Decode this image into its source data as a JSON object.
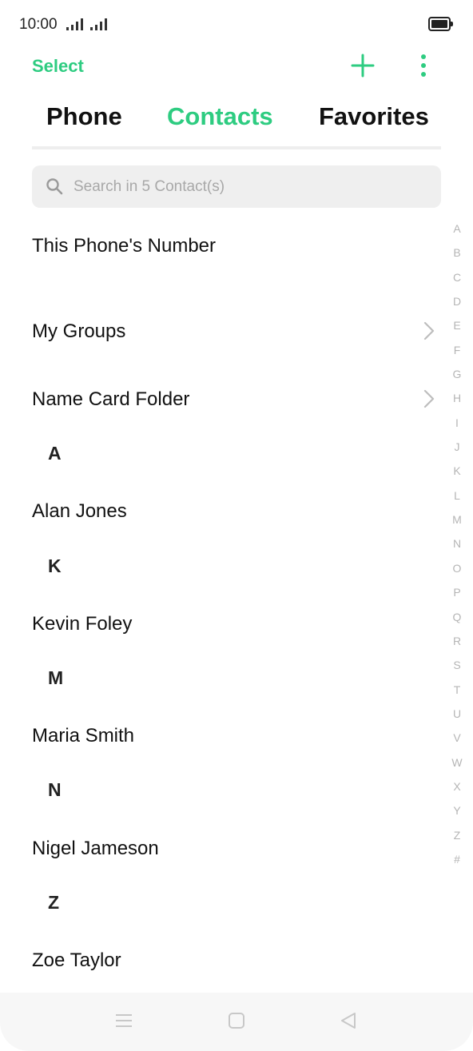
{
  "status_bar": {
    "time": "10:00"
  },
  "header": {
    "select_label": "Select"
  },
  "tabs": [
    {
      "label": "Phone",
      "active": false
    },
    {
      "label": "Contacts",
      "active": true
    },
    {
      "label": "Favorites",
      "active": false
    }
  ],
  "search": {
    "placeholder": "Search in 5 Contact(s)"
  },
  "menu_rows": {
    "this_phone": "This Phone's Number",
    "my_groups": "My Groups",
    "name_card_folder": "Name Card Folder"
  },
  "sections": [
    {
      "letter": "A",
      "contact": "Alan Jones"
    },
    {
      "letter": "K",
      "contact": "Kevin Foley"
    },
    {
      "letter": "M",
      "contact": "Maria Smith"
    },
    {
      "letter": "N",
      "contact": "Nigel Jameson"
    },
    {
      "letter": "Z",
      "contact": "Zoe Taylor"
    }
  ],
  "alphabet_index": [
    "A",
    "B",
    "C",
    "D",
    "E",
    "F",
    "G",
    "H",
    "I",
    "J",
    "K",
    "L",
    "M",
    "N",
    "O",
    "P",
    "Q",
    "R",
    "S",
    "T",
    "U",
    "V",
    "W",
    "X",
    "Y",
    "Z",
    "#"
  ],
  "colors": {
    "accent": "#2ecc81",
    "index_text": "#b5b5b5",
    "search_bg": "#efefef"
  },
  "icons": {
    "add": "plus-icon",
    "more": "more-vertical-icon",
    "search": "search-icon",
    "chevron": "chevron-right-icon",
    "nav_menu": "menu-icon",
    "nav_home": "home-icon",
    "nav_back": "back-icon"
  }
}
